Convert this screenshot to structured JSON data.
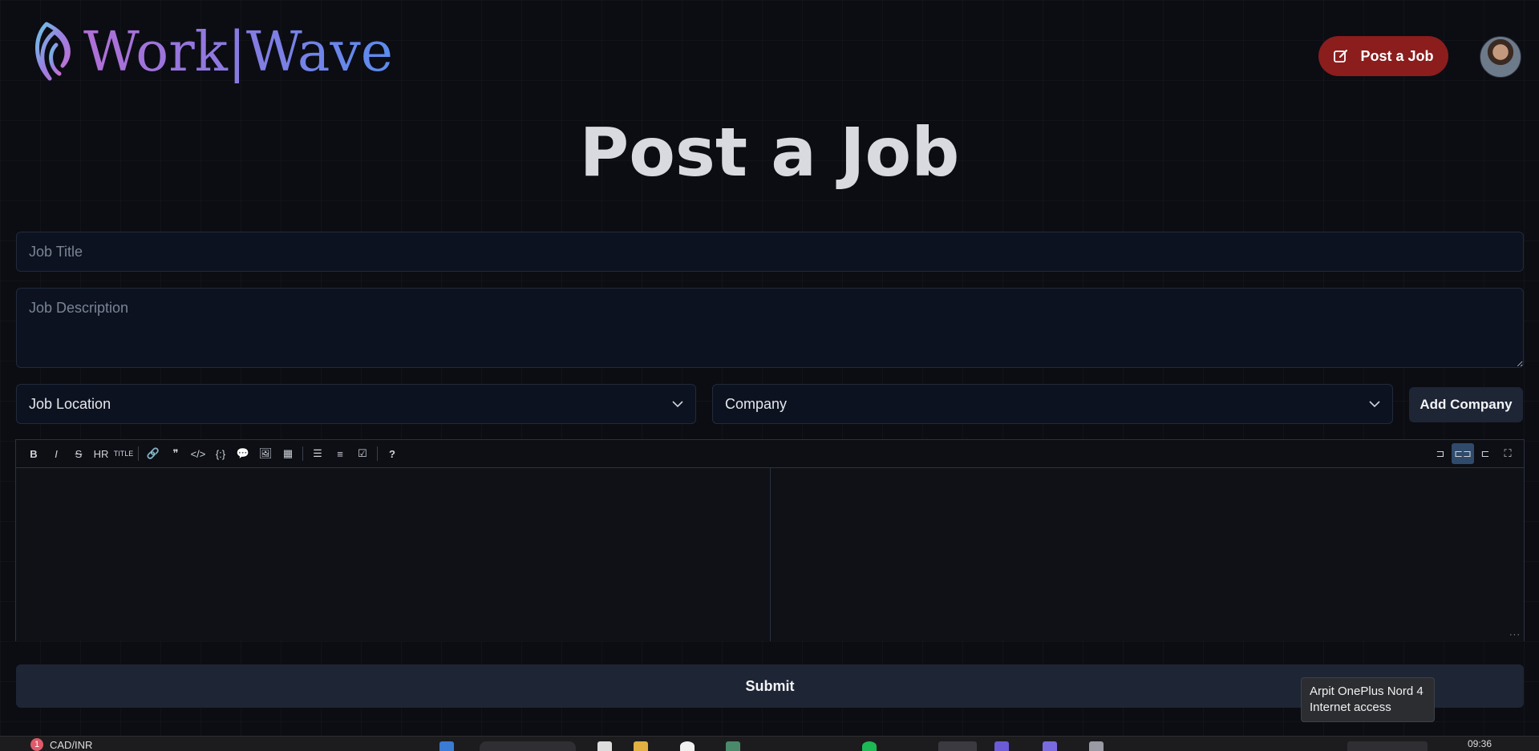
{
  "brand": {
    "name": "Work|Wave"
  },
  "header": {
    "post_job_label": "Post a Job",
    "avatar_icon": "user-avatar"
  },
  "page": {
    "title": "Post a Job"
  },
  "form": {
    "job_title_placeholder": "Job Title",
    "job_description_placeholder": "Job Description",
    "job_location_label": "Job Location",
    "company_label": "Company",
    "add_company_label": "Add Company",
    "submit_label": "Submit"
  },
  "editor": {
    "toolbar_left": [
      {
        "name": "bold-icon",
        "glyph": "B"
      },
      {
        "name": "italic-icon",
        "glyph": "I"
      },
      {
        "name": "strikethrough-icon",
        "glyph": "S"
      },
      {
        "name": "horizontal-rule-icon",
        "glyph": "HR"
      },
      {
        "name": "title-icon",
        "glyph": "TITLE"
      },
      {
        "name": "link-icon",
        "glyph": "🔗"
      },
      {
        "name": "quote-icon",
        "glyph": "❞"
      },
      {
        "name": "code-icon",
        "glyph": "</>"
      },
      {
        "name": "code-block-icon",
        "glyph": "{:}"
      },
      {
        "name": "comment-icon",
        "glyph": "💬"
      },
      {
        "name": "image-icon",
        "glyph": "🖼"
      },
      {
        "name": "table-icon",
        "glyph": "▦"
      },
      {
        "name": "unordered-list-icon",
        "glyph": "☰"
      },
      {
        "name": "ordered-list-icon",
        "glyph": "≡"
      },
      {
        "name": "checklist-icon",
        "glyph": "☑"
      },
      {
        "name": "help-icon",
        "glyph": "?"
      }
    ],
    "toolbar_right": [
      {
        "name": "edit-mode-icon",
        "glyph": "⊐"
      },
      {
        "name": "live-mode-icon",
        "glyph": "⊏⊐"
      },
      {
        "name": "preview-mode-icon",
        "glyph": "⊏"
      },
      {
        "name": "fullscreen-icon",
        "glyph": "⛶"
      }
    ]
  },
  "tooltip": {
    "line1": "Arpit OnePlus Nord 4",
    "line2": "Internet access"
  },
  "taskbar": {
    "badge": "1",
    "currency": "CAD/INR",
    "time": "09:36"
  },
  "colors": {
    "accent_red": "#8b1d1d",
    "panel": "#1e2535",
    "background": "#0b0d13"
  }
}
